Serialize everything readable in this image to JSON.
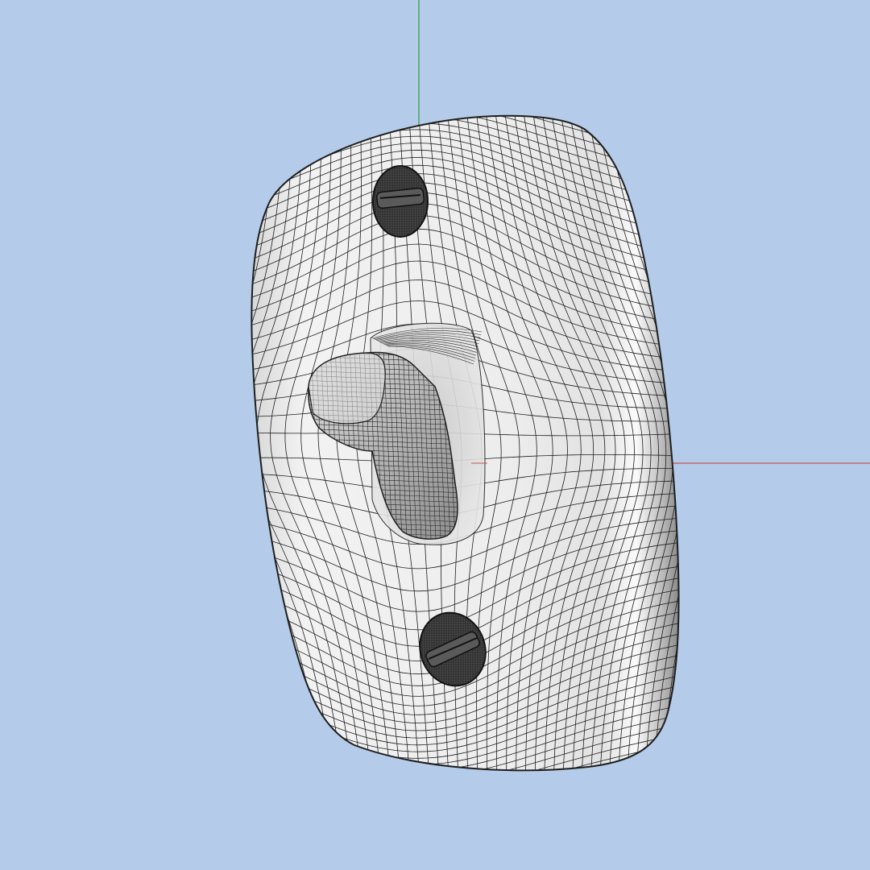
{
  "viewport": {
    "background_color": "#b4cbea",
    "render_mode": "wireframe-on-shaded",
    "object": "toggle-switch-plate-mesh"
  },
  "axes": {
    "y_axis_color": "#2e9a3e",
    "x_axis_color": "#c0585a"
  },
  "mesh": {
    "fill_color": "#ececec",
    "edge_color": "#1e1e1e",
    "screw_color": "#4a4a4a"
  }
}
